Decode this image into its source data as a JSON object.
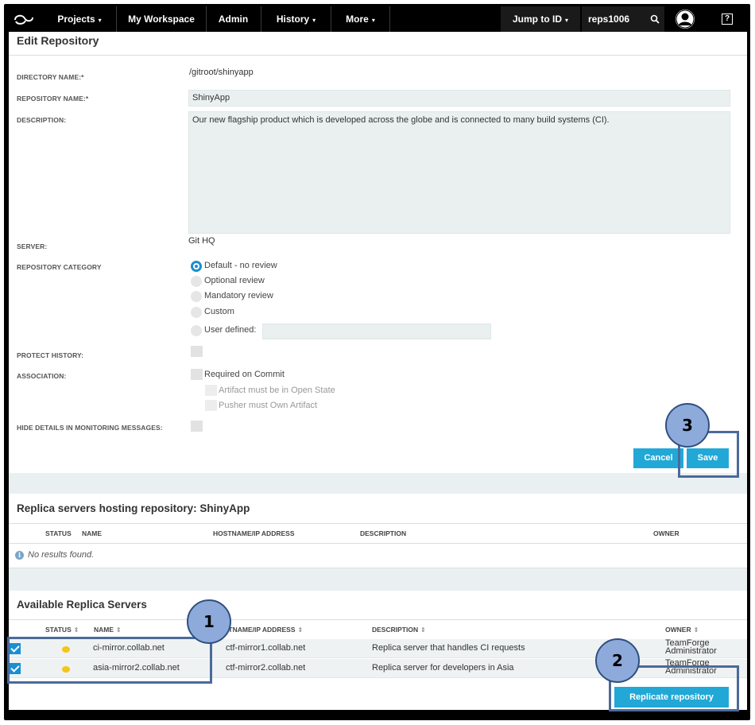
{
  "nav": {
    "projects": "Projects",
    "workspace": "My Workspace",
    "admin": "Admin",
    "history": "History",
    "more": "More",
    "jump_to": "Jump to ID",
    "search_value": "reps1006",
    "help": "?"
  },
  "form": {
    "title": "Edit Repository",
    "directory_label": "DIRECTORY NAME:*",
    "directory_value": "/gitroot/shinyapp",
    "repo_name_label": "REPOSITORY NAME:*",
    "repo_name_value": "ShinyApp",
    "description_label": "DESCRIPTION:",
    "description_value": "Our new flagship product which is developed across the globe and is connected to many build systems (CI).",
    "server_label": "SERVER:",
    "server_value": "Git HQ",
    "category_label": "REPOSITORY CATEGORY",
    "categories": [
      "Default - no review",
      "Optional review",
      "Mandatory review",
      "Custom",
      "User defined:"
    ],
    "selected_category": "Default - no review",
    "protect_label": "PROTECT HISTORY:",
    "association_label": "ASSOCIATION:",
    "required_on_commit": "Required on Commit",
    "artifact_open": "Artifact must be in Open State",
    "pusher_owns": "Pusher must Own Artifact",
    "hide_details_label": "HIDE DETAILS IN MONITORING MESSAGES:",
    "cancel": "Cancel",
    "save": "Save"
  },
  "hosting": {
    "title": "Replica servers hosting repository: ShinyApp",
    "columns": [
      "STATUS",
      "NAME",
      "HOSTNAME/IP ADDRESS",
      "DESCRIPTION",
      "OWNER"
    ],
    "empty_text": "No results found."
  },
  "available": {
    "title": "Available Replica Servers",
    "columns": [
      "STATUS",
      "NAME",
      "HOSTNAME/IP ADDRESS",
      "DESCRIPTION",
      "OWNER"
    ],
    "rows": [
      {
        "name": "ci-mirror.collab.net",
        "host": "ctf-mirror1.collab.net",
        "description": "Replica server that handles CI requests",
        "owner1": "TeamForge",
        "owner2": "Administrator"
      },
      {
        "name": "asia-mirror2.collab.net",
        "host": "ctf-mirror2.collab.net",
        "description": "Replica server for developers in Asia",
        "owner1": "TeamForge",
        "owner2": "Administrator"
      }
    ],
    "replicate_button": "Replicate repository"
  },
  "callouts": [
    "1",
    "2",
    "3"
  ],
  "colors": {
    "accent": "#22a8d6",
    "nav_bg": "#000000",
    "callout": "#8eaadb"
  }
}
